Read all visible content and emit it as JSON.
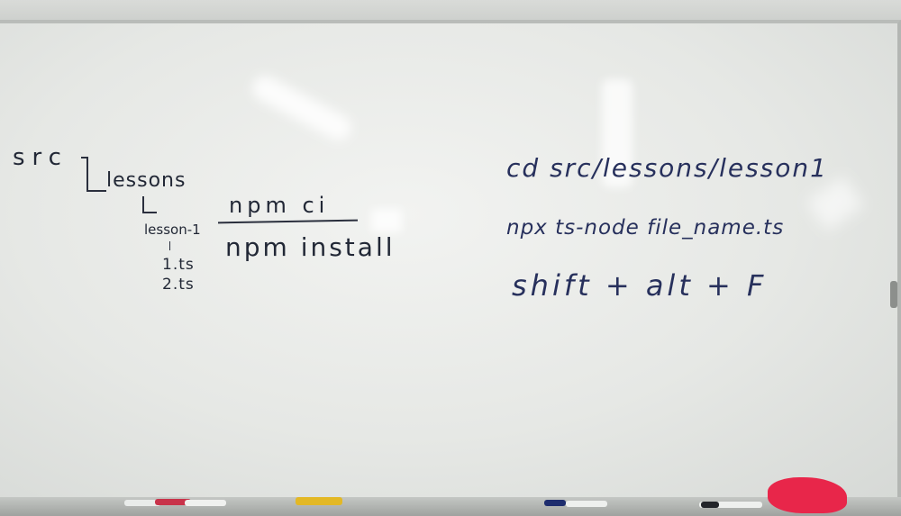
{
  "whiteboard": {
    "left": {
      "src": "src",
      "lessons": "lessons",
      "lesson1": "lesson-1",
      "file1": "1.ts",
      "file2": "2.ts"
    },
    "middle": {
      "npm_ci": "npm ci",
      "npm_install": "npm install"
    },
    "right": {
      "line1": "cd src/lessons/lesson1",
      "line2": "npx ts-node file_name.ts",
      "line3": "shift + alt + F"
    }
  },
  "colors": {
    "ink_black": "#222836",
    "ink_blue": "#27305c",
    "cloth": "#e8264a"
  }
}
